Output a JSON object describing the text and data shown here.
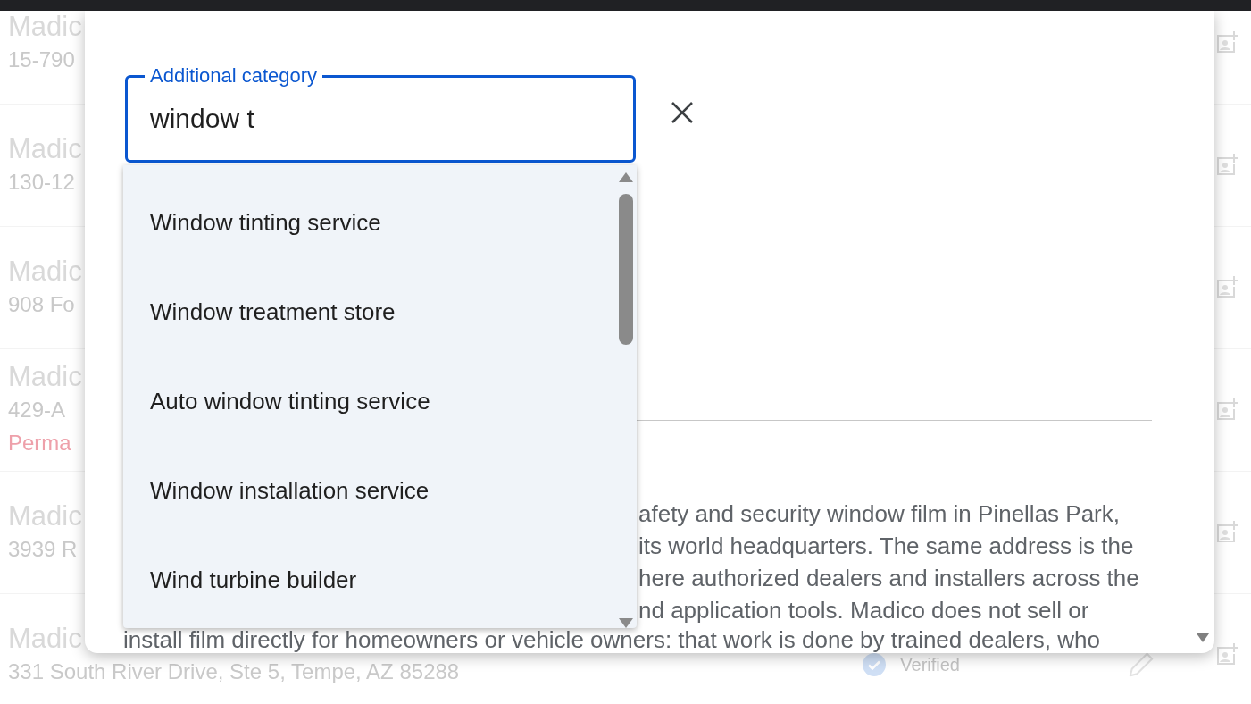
{
  "background_list": {
    "rows": [
      {
        "title": "Madic",
        "address": "15-790"
      },
      {
        "title": "Madic",
        "address": "130-12"
      },
      {
        "title": "Madic",
        "address": "908 Fo"
      },
      {
        "title": "Madic",
        "address": "429-A",
        "note": "Perma"
      },
      {
        "title": "Madic",
        "address": "3939 R"
      },
      {
        "title": "Madic",
        "address": "331 South River Drive, Ste 5, Tempe, AZ 85288",
        "badge": "Verified"
      }
    ]
  },
  "dialog": {
    "category_field": {
      "label": "Additional category",
      "value": "window t",
      "focused": true
    },
    "suggestions": [
      "Window tinting service",
      "Window treatment store",
      "Auto window tinting service",
      "Window installation service",
      "Wind turbine builder"
    ],
    "description": {
      "lines_beside_dropdown": [
        "afety and security window film in Pinellas Park,",
        "its world headquarters. The same address is the",
        "here authorized dealers and installers across the",
        "nd application tools. Madico does not sell or"
      ],
      "line_below_dropdown": "install film directly for homeowners or vehicle owners: that work is done by trained dealers, who"
    }
  }
}
